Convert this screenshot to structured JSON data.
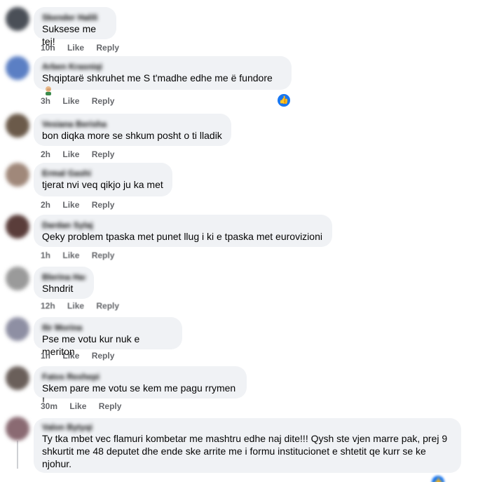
{
  "comments": [
    {
      "author": "Skender Halili",
      "text": "Suksese me tej!",
      "time": "10h",
      "like": "Like",
      "reply": "Reply"
    },
    {
      "author": "Arben Krasniqi",
      "text": "Shqiptarë shkruhet me S t'madhe edhe me ë fundore",
      "time": "3h",
      "like": "Like",
      "reply": "Reply"
    },
    {
      "author": "Vesiana Berisha",
      "text": "bon diqka more se shkum posht o ti lladik",
      "time": "2h",
      "like": "Like",
      "reply": "Reply"
    },
    {
      "author": "Ermal Gashi",
      "text": "tjerat nvi veq qikjo ju ka met",
      "time": "2h",
      "like": "Like",
      "reply": "Reply"
    },
    {
      "author": "Dardan Sylaj",
      "text": "Qeky problem tpaska met punet llug i ki e tpaska met eurovizioni",
      "time": "1h",
      "like": "Like",
      "reply": "Reply"
    },
    {
      "author": "Blerina Hasani",
      "text": "Shndrit",
      "time": "12h",
      "like": "Like",
      "reply": "Reply"
    },
    {
      "author": "Ilir Morina",
      "text": "Pse me votu kur nuk e meriton",
      "time": "1h",
      "like": "Like",
      "reply": "Reply"
    },
    {
      "author": "Fatos Rexhepi",
      "text": "Skem pare me votu se kem me pagu rrymen !",
      "time": "30m",
      "like": "Like",
      "reply": "Reply"
    },
    {
      "author": "Valon Bytyqi",
      "text": "Ty tka mbet vec flamuri kombetar me mashtru edhe naj dite!!! Qysh ste vjen marre pak, prej 9 shkurtit me 48 deputet dhe ende ske arrite me i formu institucionet e shtetit qe kurr se ke njohur."
    }
  ],
  "colors": {
    "bubble": "#f0f2f5",
    "meta": "#65676b",
    "accent": "#1877f2"
  },
  "icons": [
    "man-facepalming-emoji",
    "thumbs-up-reaction-icon"
  ]
}
